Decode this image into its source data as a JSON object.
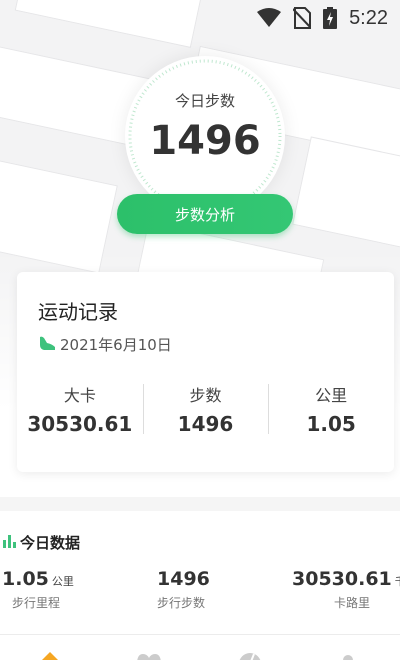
{
  "status_bar": {
    "time": "5:22",
    "icons": [
      "wifi-icon",
      "no-sim-icon",
      "battery-charging-icon"
    ]
  },
  "step_widget": {
    "label": "今日步数",
    "count": "1496"
  },
  "analysis_button": {
    "label": "步数分析"
  },
  "record_card": {
    "title": "运动记录",
    "date": "2021年6月10日",
    "stats": [
      {
        "label": "大卡",
        "value": "30530.61"
      },
      {
        "label": "步数",
        "value": "1496"
      },
      {
        "label": "公里",
        "value": "1.05"
      }
    ]
  },
  "today_data": {
    "title": "今日数据",
    "items": [
      {
        "value": "1.05",
        "unit": "公里",
        "desc": "步行里程"
      },
      {
        "value": "1496",
        "unit": "",
        "desc": "步行步数"
      },
      {
        "value": "30530.61",
        "unit": "千",
        "desc": "卡路里"
      }
    ]
  },
  "tab_bar": {
    "icons": [
      "home-icon",
      "heart-icon",
      "chart-pie-icon",
      "profile-icon"
    ]
  },
  "colors": {
    "accent": "#2cc06a",
    "text": "#333333",
    "background": "#f3f3f4"
  }
}
